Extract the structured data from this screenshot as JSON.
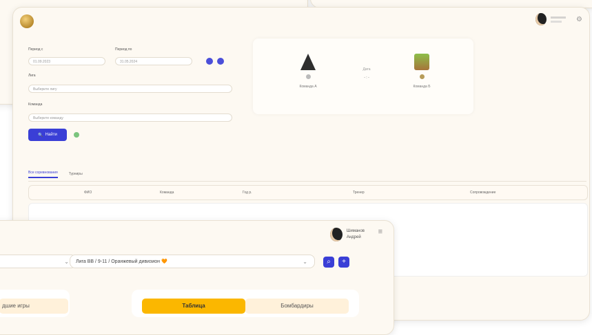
{
  "main": {
    "filters": {
      "date_from_label": "Период с",
      "date_from_value": "01.09.2023",
      "date_to_label": "Период по",
      "date_to_value": "31.05.2024",
      "league_label": "Лига",
      "league_placeholder": "Выберите лигу",
      "team_label": "Команда",
      "team_placeholder": "Выберите команду",
      "find_label": "Найти"
    },
    "match": {
      "home_team": "Команда А",
      "away_team": "Команда Б",
      "date": "Дата",
      "score": "- : -"
    },
    "tabs": [
      "Все соревнования",
      "Турниры"
    ],
    "table_headers": [
      "ФИО",
      "Команда",
      "Год р.",
      "Тренер",
      "Сопровождение"
    ]
  },
  "front": {
    "user_first": "Шиманов",
    "user_last": "Андрей",
    "league_select": "Лига BB / 9-11 / Оранжевый дивизион 🧡",
    "left_panel_label": "дшие игры",
    "tab_table": "Таблица",
    "tab_scorers": "Бомбардиры"
  },
  "colors": {
    "accent": "#3a3fd6",
    "active_tab": "#fbb700",
    "inactive_tab": "#fff1da",
    "background": "#fdf9f2"
  }
}
